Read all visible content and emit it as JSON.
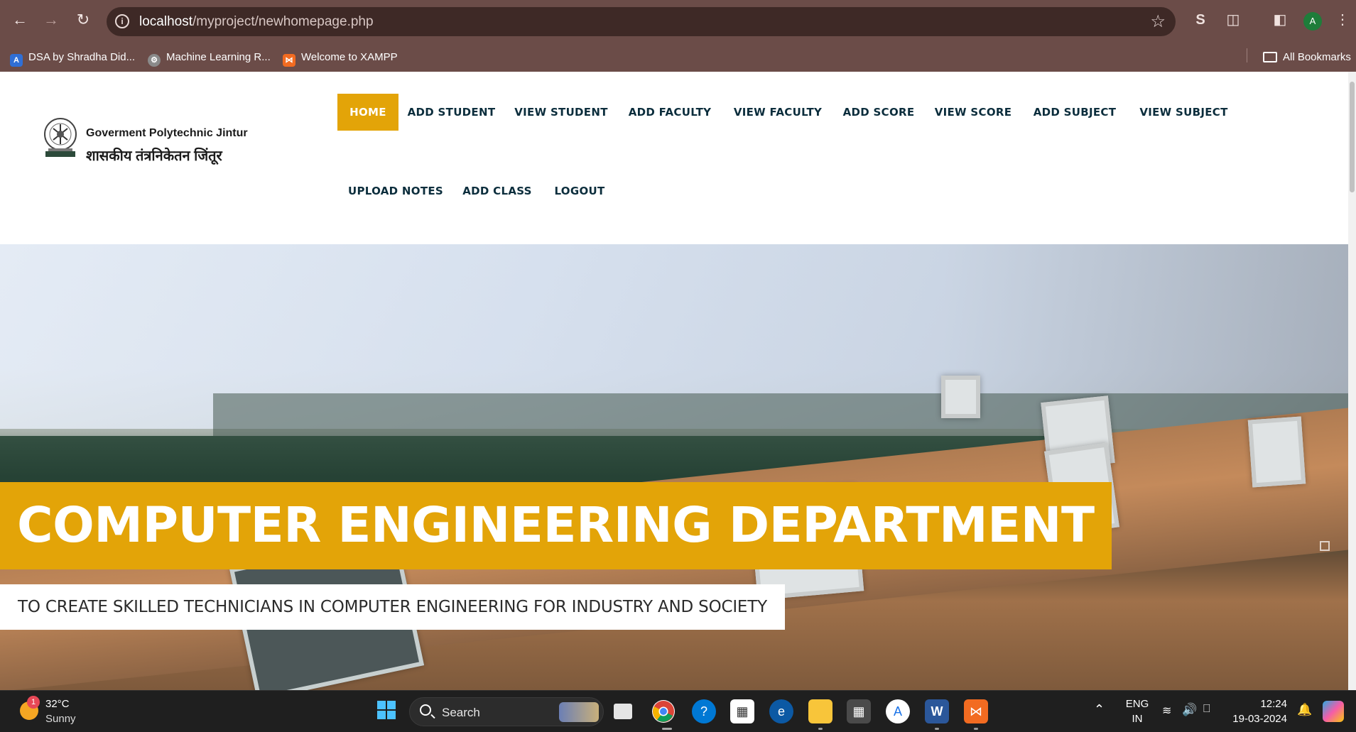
{
  "browser": {
    "url_host": "localhost",
    "url_path": "/myproject/newhomepage.php",
    "bookmarks": [
      {
        "label": "DSA by Shradha Did...",
        "icon": "apna-college-icon",
        "color": "#2f6fd6"
      },
      {
        "label": "Machine Learning R...",
        "icon": "gear-logo-icon",
        "color": "#8a8a8a"
      },
      {
        "label": "Welcome to XAMPP",
        "icon": "xampp-icon",
        "color": "#f26b21"
      }
    ],
    "all_bookmarks": "All Bookmarks",
    "profile_initial": "A"
  },
  "site": {
    "brand_en": "Goverment Polytechnic Jintur",
    "brand_mr": "शासकीय तंत्रनिकेतन जिंतूर",
    "accent": "#e3a408",
    "nav": [
      {
        "label": "HOME",
        "active": true
      },
      {
        "label": "ADD STUDENT"
      },
      {
        "label": "VIEW STUDENT"
      },
      {
        "label": "ADD FACULTY"
      },
      {
        "label": "VIEW FACULTY"
      },
      {
        "label": "ADD SCORE"
      },
      {
        "label": "VIEW SCORE"
      },
      {
        "label": "ADD SUBJECT"
      },
      {
        "label": "VIEW SUBJECT"
      },
      {
        "label": "UPLOAD NOTES"
      },
      {
        "label": "ADD CLASS"
      },
      {
        "label": "LOGOUT"
      }
    ],
    "hero_title": "COMPUTER ENGINEERING DEPARTMENT",
    "hero_subtitle": "TO CREATE SKILLED TECHNICIANS IN COMPUTER ENGINEERING FOR INDUSTRY AND SOCIETY"
  },
  "taskbar": {
    "weather_temp": "32°C",
    "weather_desc": "Sunny",
    "weather_badge": "1",
    "search_label": "Search",
    "lang_1": "ENG",
    "lang_2": "IN",
    "time": "12:24",
    "date": "19-03-2024"
  }
}
